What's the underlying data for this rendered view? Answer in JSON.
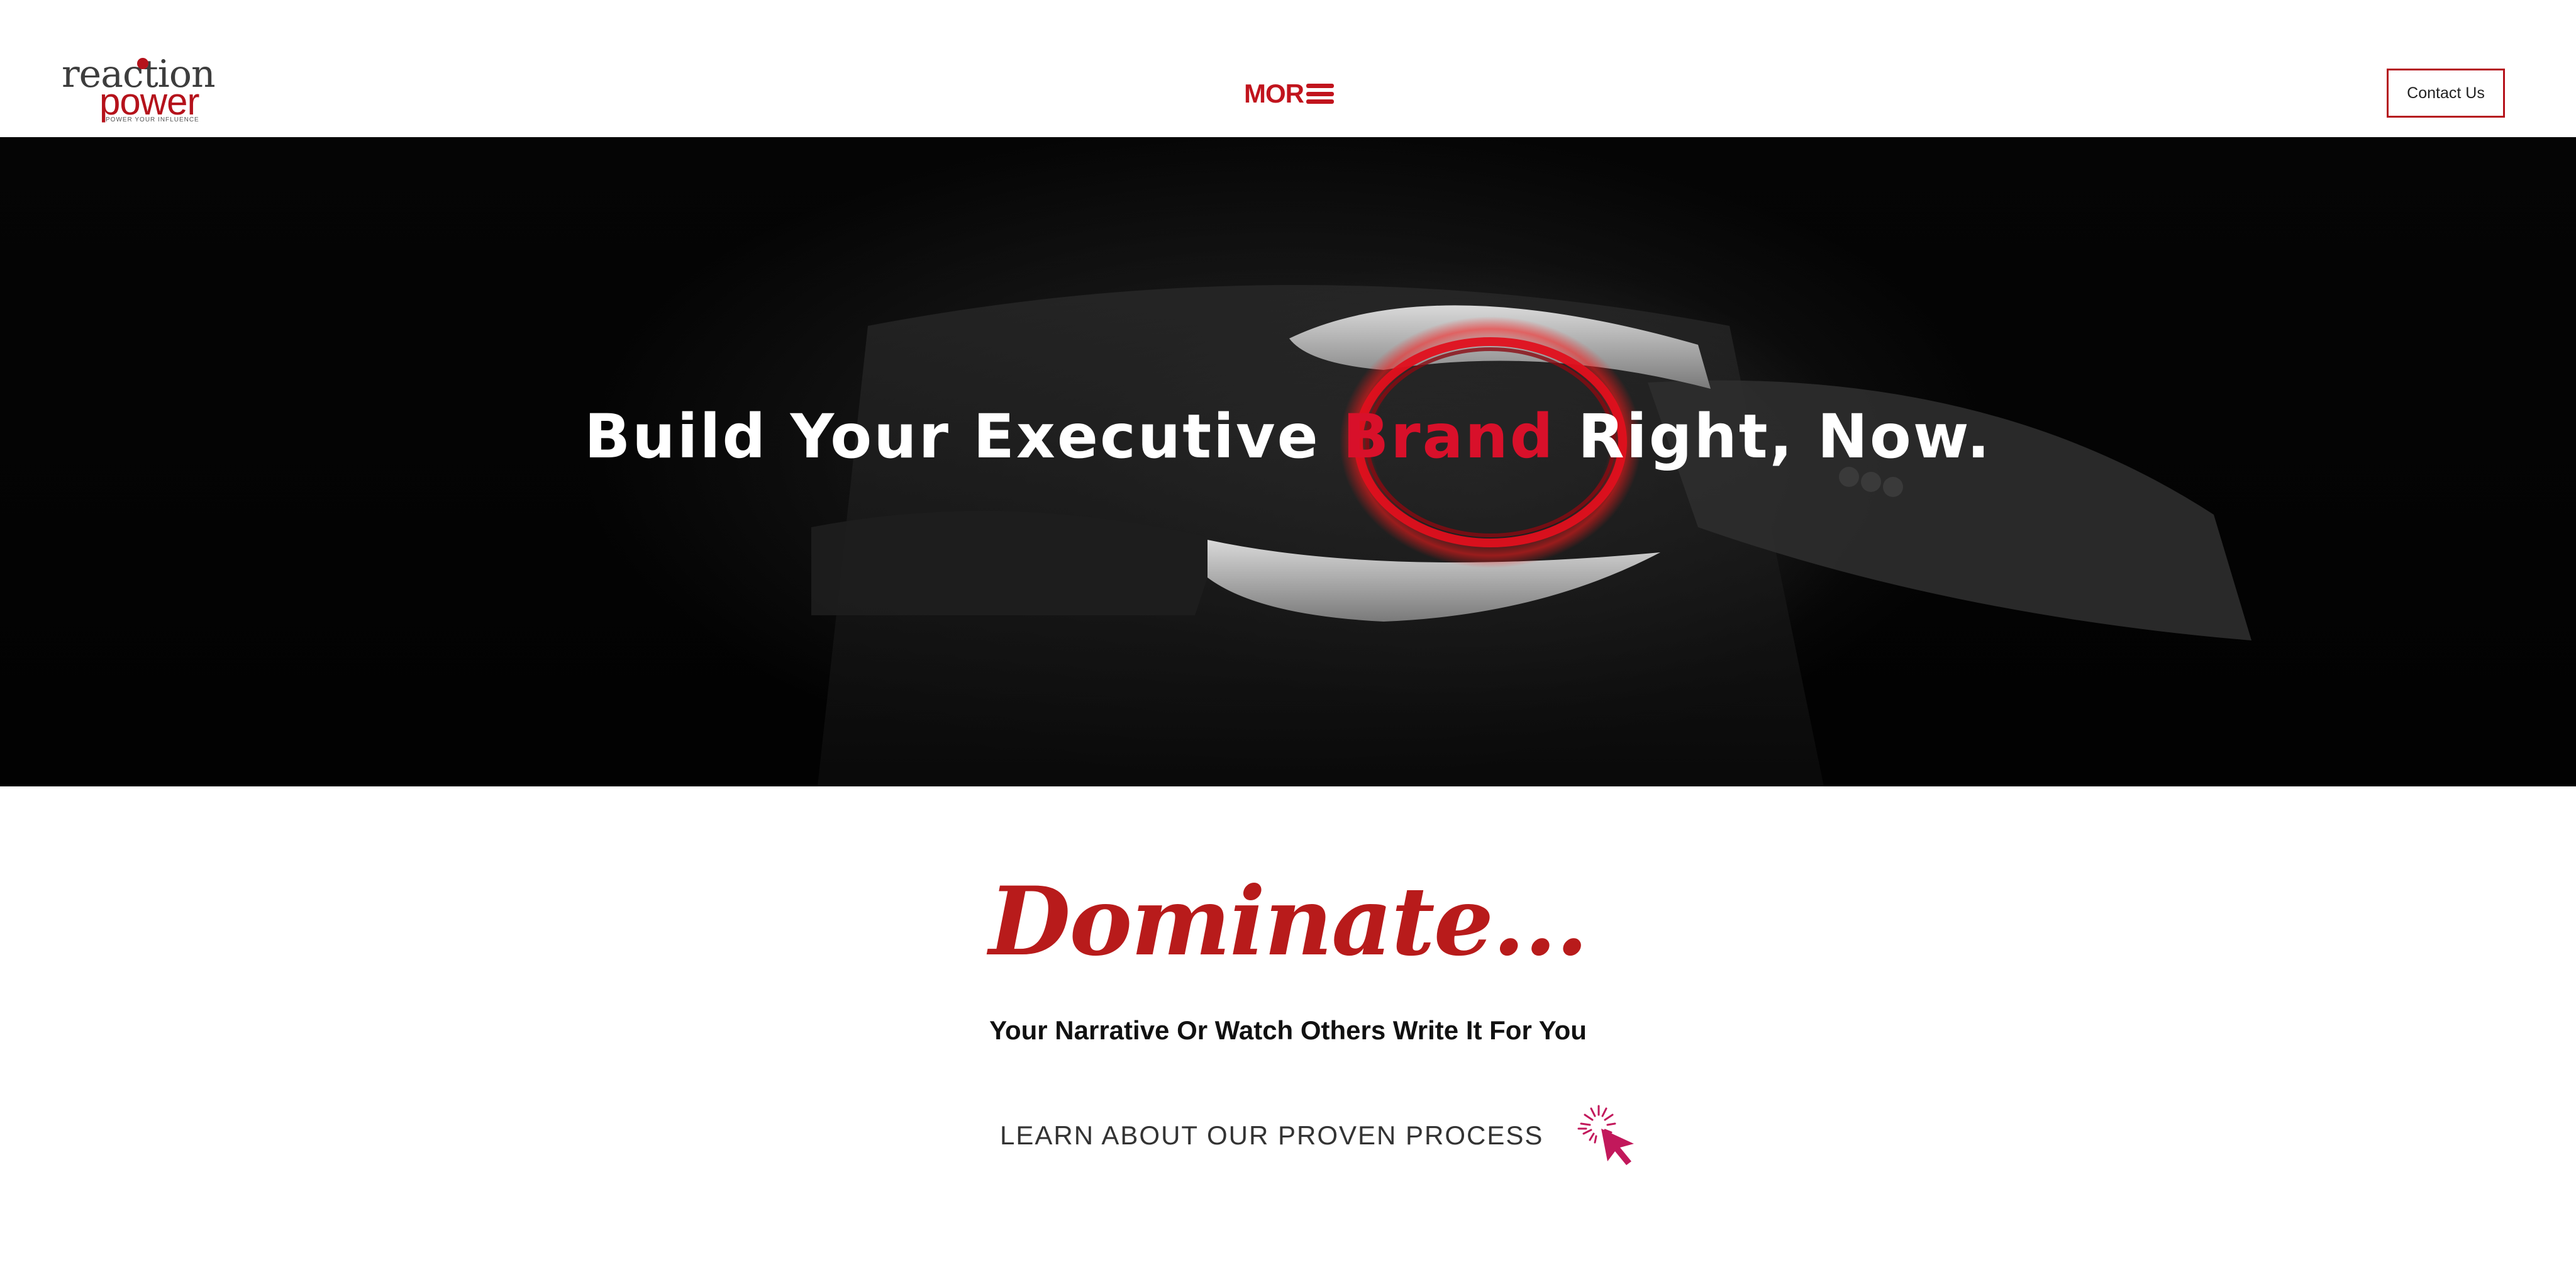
{
  "header": {
    "logo": {
      "word1": "reaction",
      "word2": "power",
      "tagline": "POWER YOUR INFLUENCE"
    },
    "more_label": "MOR",
    "contact_label": "Contact Us"
  },
  "hero": {
    "title_before": "Build Your Executive ",
    "title_accent": "Brand",
    "title_after": " Right, Now."
  },
  "content": {
    "script_heading": "Dominate...",
    "subtitle": "Your Narrative Or Watch Others Write It For You",
    "cta_label": "LEARN ABOUT OUR PROVEN PROCESS"
  },
  "colors": {
    "brand_red": "#b5121b",
    "accent_red": "#d8102a",
    "hero_bg": "#030303"
  },
  "icons": {
    "menu": "hamburger-icon",
    "cta": "click-cursor-icon"
  }
}
